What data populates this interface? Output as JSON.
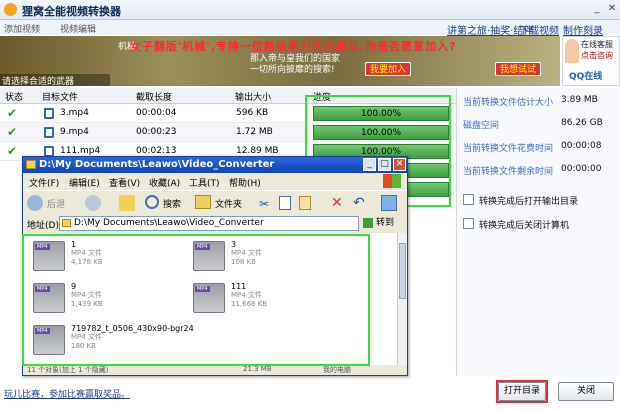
{
  "app": {
    "title": "狸窝全能视频转换器"
  },
  "top_links": [
    "讲第之旅·抽奖·结伴",
    "下载视频",
    "制作刻录DVD"
  ],
  "banner": {
    "left_tabs": [
      "添加视频",
      "视频编辑"
    ],
    "caption": "机械",
    "headline": "女子翻版'机械',专持一位超级暴力的男狼队,你是否愿意加入?",
    "sub_lines": [
      "那入帝与皇我们的国家",
      "一切所向披靡的搜索!"
    ],
    "button1": "我要加入",
    "button2": "我想试试",
    "bottom_note": "请选择合适的武器"
  },
  "support": {
    "line1": "在线客服",
    "line2": "点击咨询",
    "qq": "QQ在线"
  },
  "table": {
    "headers": [
      "状态",
      "目标文件",
      "截取长度",
      "输出大小",
      "进度"
    ],
    "rows": [
      {
        "file": "3.mp4",
        "duration": "00:00:04",
        "size": "596 KB",
        "progress": "100.00%"
      },
      {
        "file": "9.mp4",
        "duration": "00:00:23",
        "size": "1.72 MB",
        "progress": "100.00%"
      },
      {
        "file": "111.mp4",
        "duration": "00:02:13",
        "size": "12.89 MB",
        "progress": "100.00%"
      }
    ]
  },
  "right_panel": {
    "stats": [
      {
        "label": "当前转换文件估计大小",
        "value": "3.89 MB"
      },
      {
        "label": "磁盘空间",
        "value": "86.26 GB"
      },
      {
        "label": "当前转换文件花费时间",
        "value": "00:00:08"
      },
      {
        "label": "当前转换文件剩余时间",
        "value": "00:00:00"
      }
    ],
    "options": [
      "转换完成后打开输出目录",
      "转换完成后关闭计算机"
    ]
  },
  "explorer": {
    "path": "D:\\My Documents\\Leawo\\Video_Converter",
    "menu": [
      "文件(F)",
      "编辑(E)",
      "查看(V)",
      "收藏(A)",
      "工具(T)",
      "帮助(H)"
    ],
    "toolbar": {
      "back": "后退",
      "search": "搜索",
      "folders": "文件夹"
    },
    "address_label": "地址(D)",
    "go_label": "转到",
    "files": [
      {
        "name": "1",
        "type": "MP4 文件",
        "size": "4,178 KB"
      },
      {
        "name": "3",
        "type": "MP4 文件",
        "size": "108 KB"
      },
      {
        "name": "9",
        "type": "MP4 文件",
        "size": "1,439 KB"
      },
      {
        "name": "111",
        "type": "MP4 文件",
        "size": "11,668 KB"
      },
      {
        "name": "719782_t_0506_430x90-bgr24",
        "type": "MP4 文件",
        "size": "180 KB"
      }
    ],
    "status_left": "11 个对象(加上 1 个隐藏)",
    "status_mid": "21.3 MB",
    "status_right": "我的电脑"
  },
  "footer": {
    "link": "玩儿比赛，参加比赛赢取奖品。",
    "open_dir": "打开目录",
    "close": "关闭"
  }
}
